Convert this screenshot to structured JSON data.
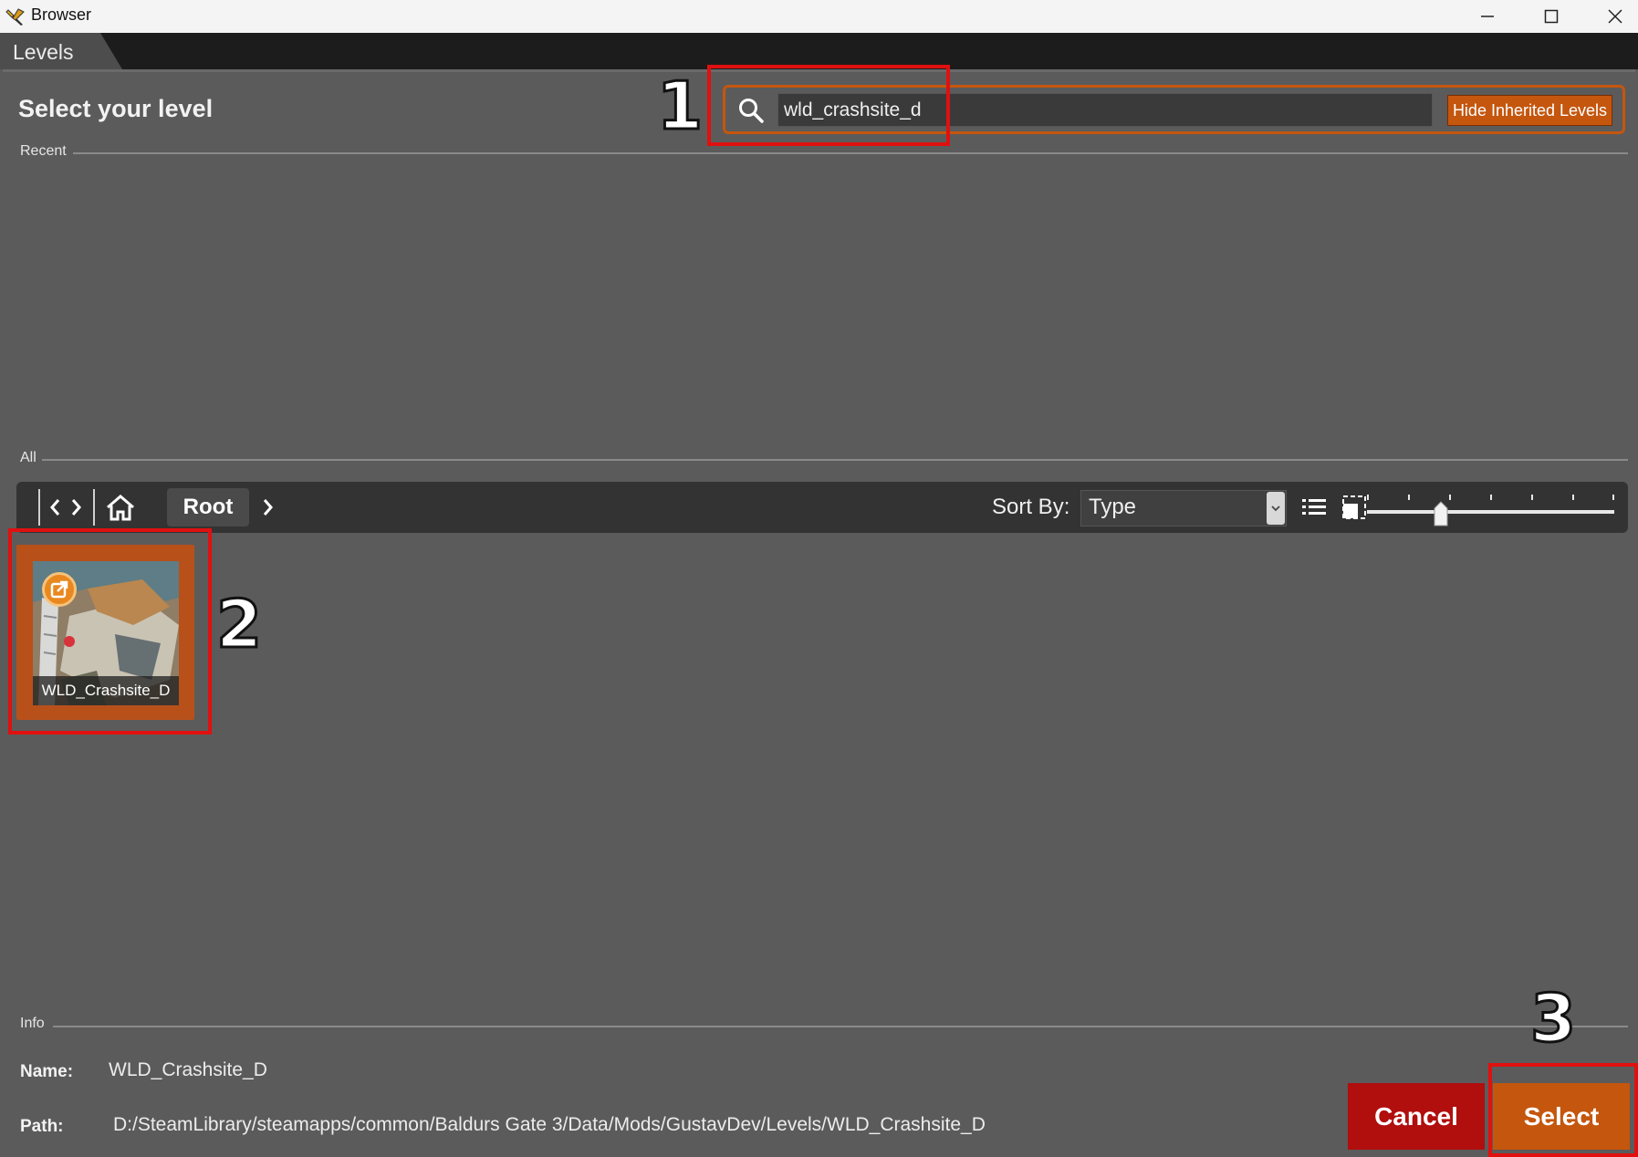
{
  "window": {
    "title": "Browser",
    "app_icon": "pen-brush-icon",
    "controls": [
      "minimize-icon",
      "maximize-icon",
      "close-icon"
    ]
  },
  "tabs": [
    {
      "label": "Levels",
      "active": true
    }
  ],
  "header": {
    "title": "Select your level",
    "search": {
      "value": "wld_crashsite_d",
      "icon": "search-icon"
    },
    "hide_inherited_label": "Hide Inherited Levels"
  },
  "sections": {
    "recent": "Recent",
    "all": "All",
    "info": "Info"
  },
  "toolbar": {
    "nav": [
      "back-icon",
      "forward-icon",
      "home-icon"
    ],
    "breadcrumb_root": "Root",
    "sort_by_label": "Sort By:",
    "sort_value": "Type",
    "view_icons": [
      "list-view-icon",
      "tile-view-icon"
    ],
    "zoom_level_fraction": 0.3
  },
  "items": [
    {
      "label": "WLD_Crashsite_D",
      "badge_icon": "external-link-icon",
      "selected": true
    }
  ],
  "info": {
    "name_key": "Name:",
    "name_value": "WLD_Crashsite_D",
    "path_key": "Path:",
    "path_value": "D:/SteamLibrary/steamapps/common/Baldurs Gate 3/Data/Mods/GustavDev/Levels/WLD_Crashsite_D"
  },
  "buttons": {
    "cancel": "Cancel",
    "select": "Select"
  },
  "annotations": [
    "1",
    "2",
    "3"
  ],
  "colors": {
    "accent": "#c4560e",
    "danger": "#b10e0e",
    "background": "#5b5b5b",
    "annotation": "#e01010"
  }
}
